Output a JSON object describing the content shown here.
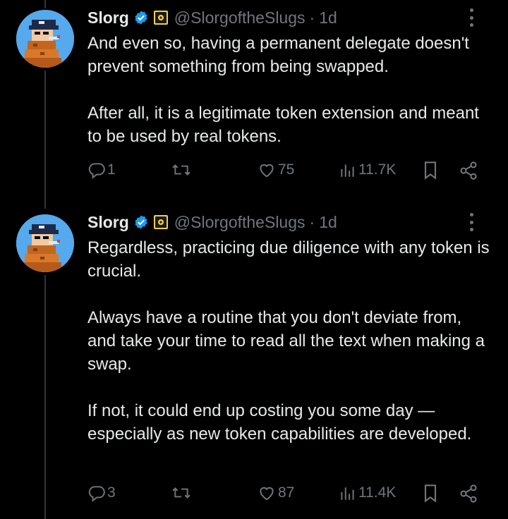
{
  "tweets": [
    {
      "author": "Slorg",
      "handle": "@SlorgoftheSlugs",
      "time": "1d",
      "paragraphs": [
        "And even so, having a permanent delegate doesn't prevent something from being swapped.",
        "After all, it is a legitimate token extension and meant to be used by real tokens."
      ],
      "replies": "1",
      "retweets": "",
      "likes": "75",
      "views": "11.7K"
    },
    {
      "author": "Slorg",
      "handle": "@SlorgoftheSlugs",
      "time": "1d",
      "paragraphs": [
        "Regardless, practicing due diligence with any token is crucial.",
        "Always have a routine that you don't deviate from, and take your time to read all the text when making a swap.",
        "If not, it could end up costing you some day — especially as new token capabilities are developed."
      ],
      "replies": "3",
      "retweets": "",
      "likes": "87",
      "views": "11.4K"
    }
  ],
  "icons": {
    "verified": "verified-badge-icon",
    "affiliate": "affiliate-badge-icon",
    "more": "more-icon",
    "reply": "reply-icon",
    "retweet": "retweet-icon",
    "like": "like-icon",
    "views": "views-icon",
    "bookmark": "bookmark-icon",
    "share": "share-icon"
  },
  "colors": {
    "background": "#000000",
    "text": "#e7e9ea",
    "muted": "#71767b",
    "verified": "#1d9bf0",
    "avatar_bg": "#55a9ec"
  }
}
